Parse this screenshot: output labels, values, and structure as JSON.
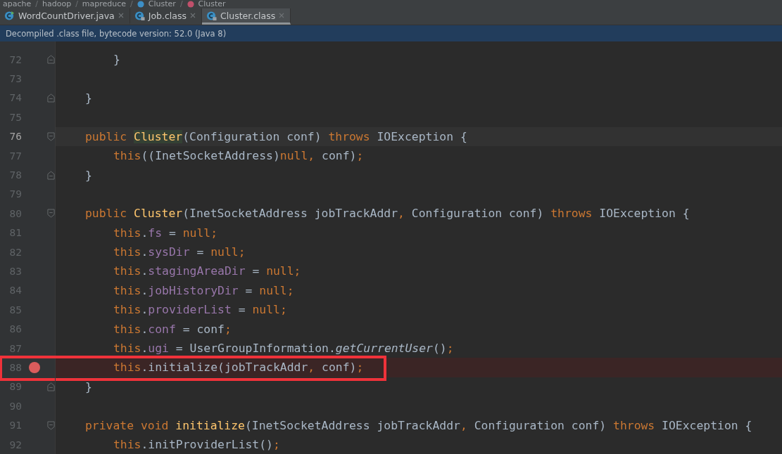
{
  "breadcrumb": [
    {
      "kind": "package",
      "label": "apache"
    },
    {
      "kind": "separator",
      "label": "/"
    },
    {
      "kind": "package",
      "label": "hadoop"
    },
    {
      "kind": "separator",
      "label": "/"
    },
    {
      "kind": "package",
      "label": "mapreduce"
    },
    {
      "kind": "separator",
      "label": "/"
    },
    {
      "kind": "class",
      "label": "Cluster"
    },
    {
      "kind": "separator",
      "label": "/"
    },
    {
      "kind": "method",
      "label": "Cluster"
    }
  ],
  "tabs": [
    {
      "label": "WordCountDriver.java",
      "selected": false,
      "locked": false
    },
    {
      "label": "Job.class",
      "selected": false,
      "locked": true
    },
    {
      "label": "Cluster.class",
      "selected": true,
      "locked": true
    }
  ],
  "banner": "Decompiled .class file, bytecode version: 52.0 (Java 8)",
  "lines": [
    {
      "number": "72",
      "kind": "statement",
      "fold_start": false,
      "fold_end": true,
      "current": false,
      "breakpoint": false,
      "annotated": false,
      "tokens": [
        {
          "text": "}",
          "kind": "plain"
        }
      ]
    },
    {
      "number": "73",
      "kind": "blank",
      "fold_start": false,
      "fold_end": false,
      "current": false,
      "breakpoint": false,
      "annotated": false
    },
    {
      "number": "74",
      "kind": "member",
      "fold_start": false,
      "fold_end": true,
      "current": false,
      "breakpoint": false,
      "annotated": false,
      "tokens": [
        {
          "text": "}",
          "kind": "plain"
        }
      ]
    },
    {
      "number": "75",
      "kind": "blank",
      "fold_start": false,
      "fold_end": false,
      "current": false,
      "breakpoint": false,
      "annotated": false
    },
    {
      "number": "76",
      "kind": "member",
      "fold_start": true,
      "fold_end": false,
      "current": true,
      "breakpoint": false,
      "annotated": false,
      "tokens": [
        {
          "text": "public ",
          "kind": "keyword"
        },
        {
          "text": "Cluster",
          "kind": "highlighted"
        },
        {
          "text": "(Configuration conf) ",
          "kind": "plain"
        },
        {
          "text": "throws ",
          "kind": "keyword"
        },
        {
          "text": "IOException {",
          "kind": "plain"
        }
      ]
    },
    {
      "number": "77",
      "kind": "statement",
      "fold_start": false,
      "fold_end": false,
      "current": false,
      "breakpoint": false,
      "annotated": false,
      "tokens": [
        {
          "text": "this",
          "kind": "keyword"
        },
        {
          "text": "((InetSocketAddress)",
          "kind": "plain"
        },
        {
          "text": "null",
          "kind": "keyword"
        },
        {
          "text": ", ",
          "kind": "keyword"
        },
        {
          "text": "conf)",
          "kind": "plain"
        },
        {
          "text": ";",
          "kind": "keyword"
        }
      ]
    },
    {
      "number": "78",
      "kind": "member",
      "fold_start": false,
      "fold_end": true,
      "current": false,
      "breakpoint": false,
      "annotated": false,
      "tokens": [
        {
          "text": "}",
          "kind": "plain"
        }
      ]
    },
    {
      "number": "79",
      "kind": "blank",
      "fold_start": false,
      "fold_end": false,
      "current": false,
      "breakpoint": false,
      "annotated": false
    },
    {
      "number": "80",
      "kind": "member",
      "fold_start": true,
      "fold_end": false,
      "current": false,
      "breakpoint": false,
      "annotated": false,
      "tokens": [
        {
          "text": "public ",
          "kind": "keyword"
        },
        {
          "text": "Cluster",
          "kind": "declaration"
        },
        {
          "text": "(InetSocketAddress jobTrackAddr",
          "kind": "plain"
        },
        {
          "text": ", ",
          "kind": "keyword"
        },
        {
          "text": "Configuration conf) ",
          "kind": "plain"
        },
        {
          "text": "throws ",
          "kind": "keyword"
        },
        {
          "text": "IOException {",
          "kind": "plain"
        }
      ]
    },
    {
      "number": "81",
      "kind": "statement",
      "fold_start": false,
      "fold_end": false,
      "current": false,
      "breakpoint": false,
      "annotated": false,
      "tokens": [
        {
          "text": "this",
          "kind": "keyword"
        },
        {
          "text": ".",
          "kind": "plain"
        },
        {
          "text": "fs",
          "kind": "field"
        },
        {
          "text": " = ",
          "kind": "plain"
        },
        {
          "text": "null",
          "kind": "keyword"
        },
        {
          "text": ";",
          "kind": "keyword"
        }
      ]
    },
    {
      "number": "82",
      "kind": "statement",
      "fold_start": false,
      "fold_end": false,
      "current": false,
      "breakpoint": false,
      "annotated": false,
      "tokens": [
        {
          "text": "this",
          "kind": "keyword"
        },
        {
          "text": ".",
          "kind": "plain"
        },
        {
          "text": "sysDir",
          "kind": "field"
        },
        {
          "text": " = ",
          "kind": "plain"
        },
        {
          "text": "null",
          "kind": "keyword"
        },
        {
          "text": ";",
          "kind": "keyword"
        }
      ]
    },
    {
      "number": "83",
      "kind": "statement",
      "fold_start": false,
      "fold_end": false,
      "current": false,
      "breakpoint": false,
      "annotated": false,
      "tokens": [
        {
          "text": "this",
          "kind": "keyword"
        },
        {
          "text": ".",
          "kind": "plain"
        },
        {
          "text": "stagingAreaDir",
          "kind": "field"
        },
        {
          "text": " = ",
          "kind": "plain"
        },
        {
          "text": "null",
          "kind": "keyword"
        },
        {
          "text": ";",
          "kind": "keyword"
        }
      ]
    },
    {
      "number": "84",
      "kind": "statement",
      "fold_start": false,
      "fold_end": false,
      "current": false,
      "breakpoint": false,
      "annotated": false,
      "tokens": [
        {
          "text": "this",
          "kind": "keyword"
        },
        {
          "text": ".",
          "kind": "plain"
        },
        {
          "text": "jobHistoryDir",
          "kind": "field"
        },
        {
          "text": " = ",
          "kind": "plain"
        },
        {
          "text": "null",
          "kind": "keyword"
        },
        {
          "text": ";",
          "kind": "keyword"
        }
      ]
    },
    {
      "number": "85",
      "kind": "statement",
      "fold_start": false,
      "fold_end": false,
      "current": false,
      "breakpoint": false,
      "annotated": false,
      "tokens": [
        {
          "text": "this",
          "kind": "keyword"
        },
        {
          "text": ".",
          "kind": "plain"
        },
        {
          "text": "providerList",
          "kind": "field"
        },
        {
          "text": " = ",
          "kind": "plain"
        },
        {
          "text": "null",
          "kind": "keyword"
        },
        {
          "text": ";",
          "kind": "keyword"
        }
      ]
    },
    {
      "number": "86",
      "kind": "statement",
      "fold_start": false,
      "fold_end": false,
      "current": false,
      "breakpoint": false,
      "annotated": false,
      "tokens": [
        {
          "text": "this",
          "kind": "keyword"
        },
        {
          "text": ".",
          "kind": "plain"
        },
        {
          "text": "conf",
          "kind": "field"
        },
        {
          "text": " = conf",
          "kind": "plain"
        },
        {
          "text": ";",
          "kind": "keyword"
        }
      ]
    },
    {
      "number": "87",
      "kind": "statement",
      "fold_start": false,
      "fold_end": false,
      "current": false,
      "breakpoint": false,
      "annotated": false,
      "tokens": [
        {
          "text": "this",
          "kind": "keyword"
        },
        {
          "text": ".",
          "kind": "plain"
        },
        {
          "text": "ugi",
          "kind": "field"
        },
        {
          "text": " = UserGroupInformation.",
          "kind": "plain"
        },
        {
          "text": "getCurrentUser",
          "kind": "static"
        },
        {
          "text": "()",
          "kind": "plain"
        },
        {
          "text": ";",
          "kind": "keyword"
        }
      ]
    },
    {
      "number": "88",
      "kind": "statement",
      "fold_start": false,
      "fold_end": false,
      "current": false,
      "breakpoint": true,
      "annotated": true,
      "tokens": [
        {
          "text": "this",
          "kind": "keyword"
        },
        {
          "text": ".initialize(jobTrackAddr",
          "kind": "plain"
        },
        {
          "text": ", ",
          "kind": "keyword"
        },
        {
          "text": "conf)",
          "kind": "plain"
        },
        {
          "text": ";",
          "kind": "keyword"
        }
      ]
    },
    {
      "number": "89",
      "kind": "member",
      "fold_start": false,
      "fold_end": true,
      "current": false,
      "breakpoint": false,
      "annotated": false,
      "tokens": [
        {
          "text": "}",
          "kind": "plain"
        }
      ]
    },
    {
      "number": "90",
      "kind": "blank",
      "fold_start": false,
      "fold_end": false,
      "current": false,
      "breakpoint": false,
      "annotated": false
    },
    {
      "number": "91",
      "kind": "member",
      "fold_start": true,
      "fold_end": false,
      "current": false,
      "breakpoint": false,
      "annotated": false,
      "tokens": [
        {
          "text": "private void ",
          "kind": "keyword"
        },
        {
          "text": "initialize",
          "kind": "declaration"
        },
        {
          "text": "(InetSocketAddress jobTrackAddr",
          "kind": "plain"
        },
        {
          "text": ", ",
          "kind": "keyword"
        },
        {
          "text": "Configuration conf) ",
          "kind": "plain"
        },
        {
          "text": "throws ",
          "kind": "keyword"
        },
        {
          "text": "IOException {",
          "kind": "plain"
        }
      ]
    },
    {
      "number": "92",
      "kind": "statement",
      "fold_start": false,
      "fold_end": false,
      "current": false,
      "breakpoint": false,
      "annotated": false,
      "tokens": [
        {
          "text": "this",
          "kind": "keyword"
        },
        {
          "text": ".initProviderList()",
          "kind": "plain"
        },
        {
          "text": ";",
          "kind": "keyword"
        }
      ]
    }
  ]
}
